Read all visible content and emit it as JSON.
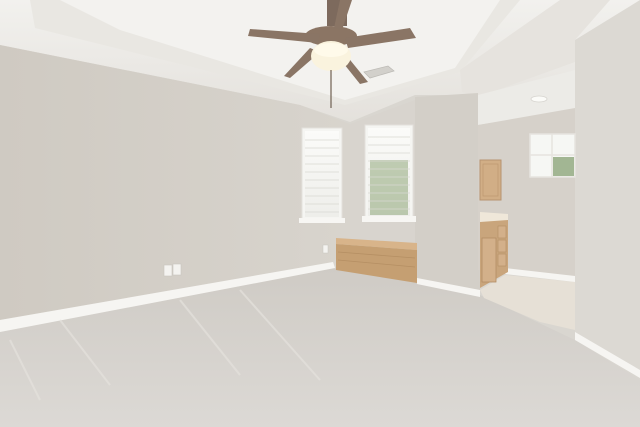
{
  "scene": {
    "subject": "vacant-bedroom-interior",
    "objects": [
      "ceiling-fan",
      "window-blinds-left",
      "window-blinds-right",
      "window-seat",
      "bathroom-vanity",
      "bathroom-window",
      "carpet-floor",
      "tile-floor",
      "wall-outlet",
      "ceiling-vent",
      "recessed-light"
    ],
    "colors": {
      "ceiling": "#eeece8",
      "wall_main": "#d4d0c9",
      "wall_back": "#d9d5cf",
      "wall_right": "#dcd9d3",
      "carpet": "#d6d2cd",
      "trim": "#f6f5f2",
      "wood": "#c9a57c",
      "fan_blade": "#8a7565"
    }
  }
}
